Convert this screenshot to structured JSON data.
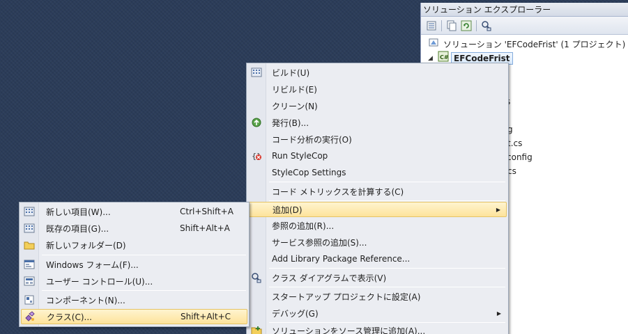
{
  "solution_explorer": {
    "title": "ソリューション エクスプローラー",
    "toolbar_icons": [
      "properties-icon",
      "show-all-files-icon",
      "refresh-icon",
      "class-diagram-icon"
    ],
    "solution_label": "ソリューション 'EFCodeFrist' (1 プロジェクト)",
    "project_label": "EFCodeFrist",
    "partial_items": [
      "s",
      "g",
      "t.cs",
      "config",
      "cs"
    ]
  },
  "context_menu": {
    "items": [
      {
        "label": "ビルド(U)",
        "icon": "build-icon"
      },
      {
        "label": "リビルド(E)",
        "icon": ""
      },
      {
        "label": "クリーン(N)",
        "icon": ""
      },
      {
        "label": "発行(B)...",
        "icon": "publish-icon"
      },
      {
        "label": "コード分析の実行(O)",
        "icon": ""
      },
      {
        "label": "Run StyleCop",
        "icon": "stylecop-icon"
      },
      {
        "label": "StyleCop Settings",
        "icon": ""
      },
      {
        "label": "コード メトリックスを計算する(C)",
        "icon": ""
      },
      {
        "label": "追加(D)",
        "icon": "",
        "highlighted": true,
        "submenu": true
      },
      {
        "label": "参照の追加(R)...",
        "icon": ""
      },
      {
        "label": "サービス参照の追加(S)...",
        "icon": ""
      },
      {
        "label": "Add Library Package Reference...",
        "icon": ""
      },
      {
        "label": "クラス ダイアグラムで表示(V)",
        "icon": "class-diagram-icon"
      },
      {
        "label": "スタートアップ プロジェクトに設定(A)",
        "icon": ""
      },
      {
        "label": "デバッグ(G)",
        "icon": "",
        "submenu": true
      },
      {
        "label": "ソリューションをソース管理に追加(A)...",
        "icon": "source-control-icon"
      }
    ]
  },
  "submenu": {
    "items": [
      {
        "label": "新しい項目(W)...",
        "shortcut": "Ctrl+Shift+A",
        "icon": "new-item-icon"
      },
      {
        "label": "既存の項目(G)...",
        "shortcut": "Shift+Alt+A",
        "icon": "existing-item-icon"
      },
      {
        "label": "新しいフォルダー(D)",
        "shortcut": "",
        "icon": "folder-icon"
      },
      {
        "label": "Windows フォーム(F)...",
        "shortcut": "",
        "icon": "windows-form-icon"
      },
      {
        "label": "ユーザー コントロール(U)...",
        "shortcut": "",
        "icon": "user-control-icon"
      },
      {
        "label": "コンポーネント(N)...",
        "shortcut": "",
        "icon": "component-icon"
      },
      {
        "label": "クラス(C)...",
        "shortcut": "Shift+Alt+C",
        "icon": "class-icon",
        "highlighted": true
      }
    ]
  },
  "colors": {
    "desktop_bg": "#2b3c59",
    "menu_bg": "#ebedf2",
    "highlight": "#fde39b"
  }
}
